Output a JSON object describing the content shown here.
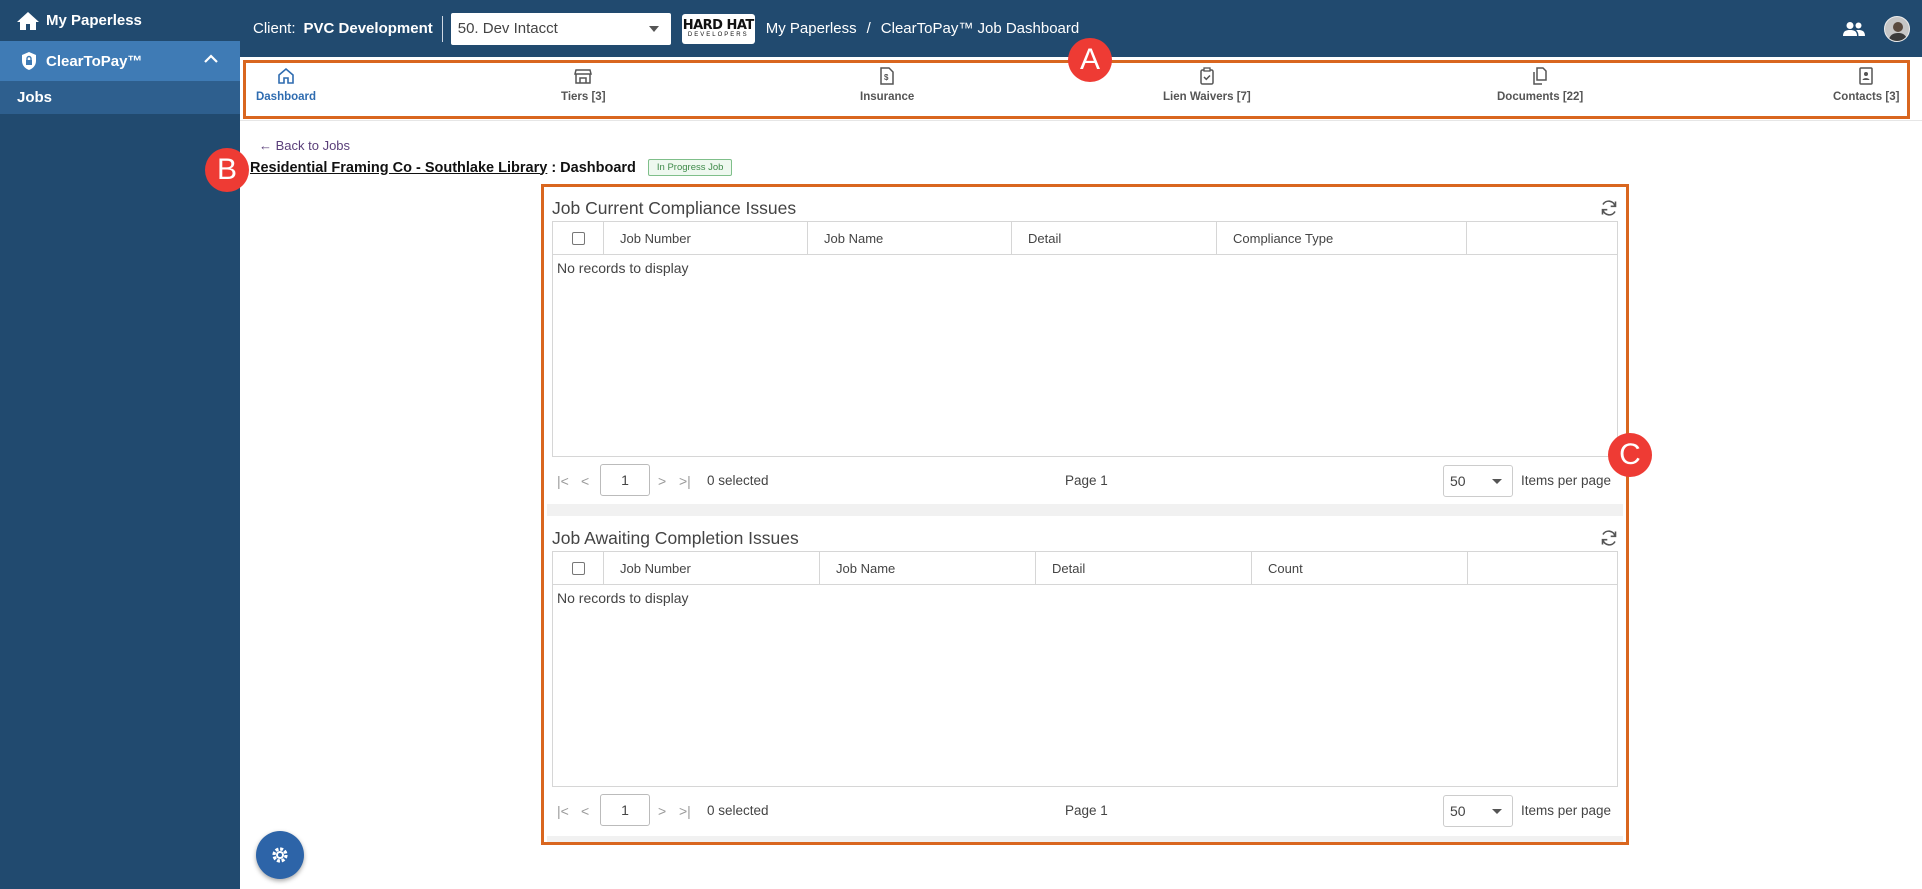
{
  "sidebar": {
    "home_label": "My Paperless",
    "product_label": "ClearToPay™",
    "items": [
      {
        "label": "Jobs"
      }
    ]
  },
  "header": {
    "client_label": "Client:",
    "client_name": "PVC Development",
    "client_select_value": "50. Dev Intacct",
    "logo_line1": "HARD HAT",
    "logo_line2": "DEVELOPERS",
    "breadcrumb": [
      "My Paperless",
      "/",
      "ClearToPay™ Job Dashboard"
    ]
  },
  "tabs": [
    {
      "label": "Dashboard",
      "icon": "home-icon",
      "active": true
    },
    {
      "label": "Tiers [3]",
      "icon": "store-icon"
    },
    {
      "label": "Insurance",
      "icon": "document-dollar-icon"
    },
    {
      "label": "Lien Waivers [7]",
      "icon": "clipboard-check-icon"
    },
    {
      "label": "Documents [22]",
      "icon": "documents-icon"
    },
    {
      "label": "Contacts [3]",
      "icon": "contact-book-icon"
    }
  ],
  "annotations": {
    "a": "A",
    "b": "B",
    "c": "C"
  },
  "page": {
    "back_link": "← Back to Jobs",
    "job_name": "Residential Framing Co - Southlake Library",
    "title_suffix": ": Dashboard",
    "status": "In Progress Job"
  },
  "compliance_panel": {
    "title": "Job Current Compliance Issues",
    "columns": [
      "Job Number",
      "Job Name",
      "Detail",
      "Compliance Type"
    ],
    "empty_text": "No records to display",
    "pager": {
      "page_input": "1",
      "selected_text": "0 selected",
      "page_text": "Page 1",
      "page_size": "50",
      "items_per_page_label": "Items per page"
    }
  },
  "awaiting_panel": {
    "title": "Job Awaiting Completion Issues",
    "columns": [
      "Job Number",
      "Job Name",
      "Detail",
      "Count"
    ],
    "empty_text": "No records to display",
    "pager": {
      "page_input": "1",
      "selected_text": "0 selected",
      "page_text": "Page 1",
      "page_size": "50",
      "items_per_page_label": "Items per page"
    }
  },
  "colors": {
    "sidebar": "#214a6f",
    "sidebar_active": "#3f7bb5",
    "accent": "#2f6cb0",
    "annotation": "#ee3b34",
    "frame": "#d9661f"
  }
}
